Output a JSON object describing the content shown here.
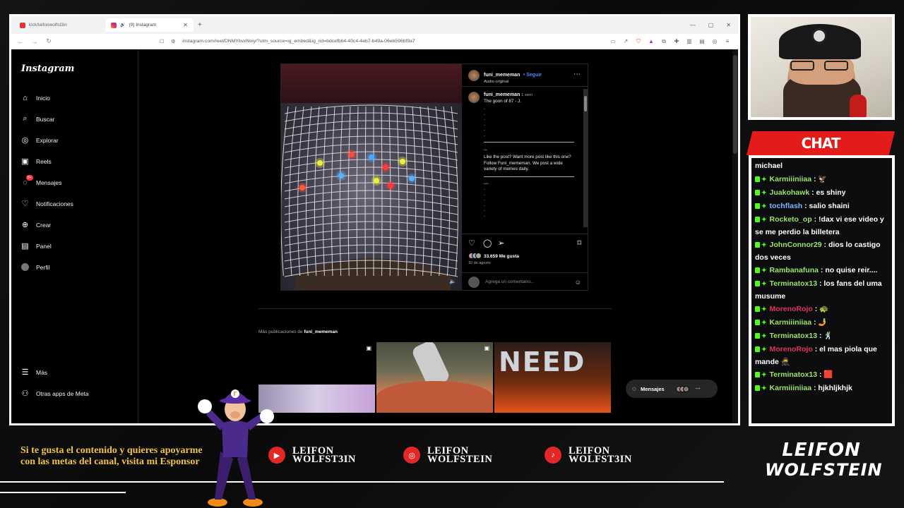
{
  "browser": {
    "tabs": [
      {
        "label": "kick/leifonwolfst3in",
        "active": false
      },
      {
        "label": "(9) Instagram",
        "active": true
      }
    ],
    "url": "instagram.com/reel/DNMYbvxNoiy/?utm_source=ig_embed&ig_rid=bdcefbb4-40c4-4eb7-b49a-06eb596bf9a7"
  },
  "instagram": {
    "logo": "Instagram",
    "nav": [
      {
        "label": "Inicio",
        "icon": "home-icon"
      },
      {
        "label": "Buscar",
        "icon": "search-icon"
      },
      {
        "label": "Explorar",
        "icon": "compass-icon"
      },
      {
        "label": "Reels",
        "icon": "reels-icon"
      },
      {
        "label": "Mensajes",
        "icon": "messenger-icon",
        "badge": "9+"
      },
      {
        "label": "Notificaciones",
        "icon": "heart-icon"
      },
      {
        "label": "Crear",
        "icon": "plus-icon"
      },
      {
        "label": "Panel",
        "icon": "dashboard-icon"
      },
      {
        "label": "Perfil",
        "icon": "avatar-icon"
      }
    ],
    "bottom_nav": [
      {
        "label": "Más",
        "icon": "menu-icon"
      },
      {
        "label": "Otras apps de Meta",
        "icon": "meta-apps-icon"
      }
    ],
    "post": {
      "username": "funi_mememan",
      "follow": "• Seguir",
      "audio": "Audio original",
      "caption_time": "1 sem",
      "caption_title": "The goon of 87 - J.",
      "caption_cta": "Like the post? Want more post like this one? Follow Funi_mememan. We post a wide variety of memes daily.",
      "likes": "33.659 Me gusta",
      "date": "10 de agosto",
      "comment_placeholder": "Agrega un comentario..."
    },
    "more_posts_prefix": "Más publicaciones de",
    "more_posts_user": "funi_mememan",
    "thumb3_text": "NEED",
    "messages_button": "Mensajes"
  },
  "chat": {
    "title": "CHAT",
    "messages": [
      {
        "user": "michael",
        "text": "",
        "color": "#ffffff"
      },
      {
        "user": "Karmiiiniiaa",
        "text": ": 🦅",
        "color": "#9be36a"
      },
      {
        "user": "Juakohawk",
        "text": ": es shiny",
        "color": "#9be36a"
      },
      {
        "user": "tochflash",
        "text": ": salio shaini",
        "color": "#7eb4ff"
      },
      {
        "user": "Rocketo_op",
        "text": ": !dax vi ese video y se me perdio la billetera",
        "color": "#9be36a"
      },
      {
        "user": "JohnConnor29",
        "text": ": dios lo castigo dos veces",
        "color": "#9be36a"
      },
      {
        "user": "Rambanafuna",
        "text": ": no quise reir....",
        "color": "#9be36a"
      },
      {
        "user": "Terminatox13",
        "text": ": los fans del uma musume",
        "color": "#9be36a"
      },
      {
        "user": "MorenoRojo",
        "text": ": 🐢",
        "color": "#e0335a"
      },
      {
        "user": "Karmiiiniiaa",
        "text": ": 🤳",
        "color": "#9be36a"
      },
      {
        "user": "Terminatox13",
        "text": ": 🕺",
        "color": "#9be36a"
      },
      {
        "user": "MorenoRojo",
        "text": ": el mas piola que mande 🥷",
        "color": "#e0335a"
      },
      {
        "user": "Terminatox13",
        "text": ": 🟥",
        "color": "#9be36a"
      },
      {
        "user": "Karmiiiniiaa",
        "text": ": hjkhljkhjk",
        "color": "#9be36a"
      }
    ]
  },
  "overlay": {
    "sponsor_text": "Si te gusta el contenido y quieres apoyarme con las metas del canal, visita mi Esponsor",
    "socials": [
      {
        "platform": "youtube-icon",
        "line1": "LEIFON",
        "line2": "WOLFST3IN"
      },
      {
        "platform": "instagram-icon",
        "line1": "LEIFON",
        "line2": "WOLFSTEIN"
      },
      {
        "platform": "tiktok-icon",
        "line1": "LEIFON",
        "line2": "WOLFST3IN"
      }
    ],
    "brand_line1": "LEIFON",
    "brand_line2": "WOLFSTEIN"
  }
}
